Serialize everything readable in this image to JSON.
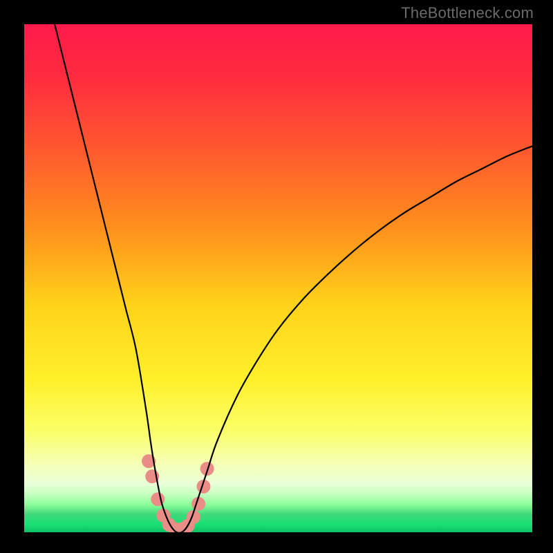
{
  "watermark": "TheBottleneck.com",
  "chart_data": {
    "type": "line",
    "title": "",
    "xlabel": "",
    "ylabel": "",
    "xlim": [
      0,
      100
    ],
    "ylim": [
      0,
      100
    ],
    "gradient_stops": [
      {
        "offset": 0.0,
        "color": "#ff1a4b"
      },
      {
        "offset": 0.1,
        "color": "#ff2b3f"
      },
      {
        "offset": 0.25,
        "color": "#ff5a2e"
      },
      {
        "offset": 0.4,
        "color": "#ff8f1c"
      },
      {
        "offset": 0.55,
        "color": "#ffd21a"
      },
      {
        "offset": 0.7,
        "color": "#fff02a"
      },
      {
        "offset": 0.8,
        "color": "#fbff67"
      },
      {
        "offset": 0.86,
        "color": "#f6ffb0"
      },
      {
        "offset": 0.905,
        "color": "#e8ffd8"
      },
      {
        "offset": 0.925,
        "color": "#c7ffc0"
      },
      {
        "offset": 0.945,
        "color": "#8cff9a"
      },
      {
        "offset": 0.965,
        "color": "#3fd87a"
      },
      {
        "offset": 0.985,
        "color": "#17e074"
      },
      {
        "offset": 1.0,
        "color": "#0fbf63"
      }
    ],
    "series": [
      {
        "name": "bottleneck-curve",
        "color": "#000000",
        "x": [
          6,
          8,
          10,
          12,
          14,
          16,
          18,
          20,
          22,
          24,
          25,
          26,
          27,
          28,
          29,
          30,
          31,
          32,
          33,
          34,
          36,
          38,
          42,
          46,
          50,
          55,
          60,
          65,
          70,
          75,
          80,
          85,
          90,
          95,
          100
        ],
        "y_percent": [
          100,
          92,
          84,
          76,
          68,
          60,
          52,
          44,
          36,
          24,
          17,
          11,
          6,
          3,
          1,
          0,
          0,
          1,
          3,
          6,
          12,
          18,
          27,
          34,
          40,
          46,
          51,
          55.5,
          59.5,
          63,
          66,
          69,
          71.5,
          74,
          76
        ]
      }
    ],
    "markers": {
      "name": "highlight-dots",
      "color": "#ea8d86",
      "radius_px": 10,
      "points": [
        {
          "x": 24.5,
          "y_percent": 14
        },
        {
          "x": 25.2,
          "y_percent": 11
        },
        {
          "x": 26.3,
          "y_percent": 6.5
        },
        {
          "x": 27.4,
          "y_percent": 3.3
        },
        {
          "x": 28.5,
          "y_percent": 1.5
        },
        {
          "x": 29.7,
          "y_percent": 0.6
        },
        {
          "x": 31.0,
          "y_percent": 0.6
        },
        {
          "x": 32.2,
          "y_percent": 1.3
        },
        {
          "x": 33.3,
          "y_percent": 3.0
        },
        {
          "x": 34.3,
          "y_percent": 5.6
        },
        {
          "x": 35.3,
          "y_percent": 9.0
        },
        {
          "x": 36.0,
          "y_percent": 12.5
        }
      ]
    }
  }
}
